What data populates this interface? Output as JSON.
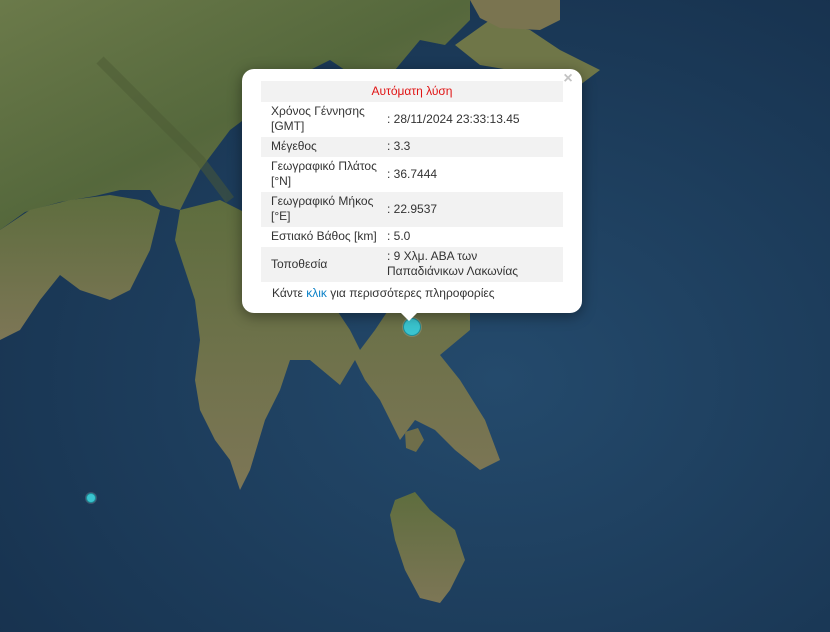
{
  "colors": {
    "marker": "#3ac4cf",
    "title_text": "#e01414",
    "link": "#0d82c8",
    "sea": "#1c3a5a",
    "land": "#556b40"
  },
  "popup": {
    "title": "Αυτόματη λύση",
    "close_symbol": "×",
    "rows": [
      {
        "label": "Χρόνος Γέννησης [GMT]",
        "value": ": 28/11/2024 23:33:13.45"
      },
      {
        "label": "Μέγεθος",
        "value": ": 3.3"
      },
      {
        "label": "Γεωγραφικό Πλάτος [°N]",
        "value": ": 36.7444"
      },
      {
        "label": "Γεωγραφικό Μήκος [°E]",
        "value": ": 22.9537"
      },
      {
        "label": "Εστιακό Βάθος [km]",
        "value": ": 5.0"
      },
      {
        "label": "Τοποθεσία",
        "value": ": 9 Χλμ. ΑΒΑ των Παπαδιάνικων Λακωνίας"
      }
    ],
    "more_prefix": "Κάντε",
    "more_link": "κλικ",
    "more_suffix": "για περισσότερες πληροφορίες"
  },
  "markers": [
    {
      "name": "selected-earthquake",
      "magnitude": 3.3
    },
    {
      "name": "other-earthquake"
    }
  ]
}
